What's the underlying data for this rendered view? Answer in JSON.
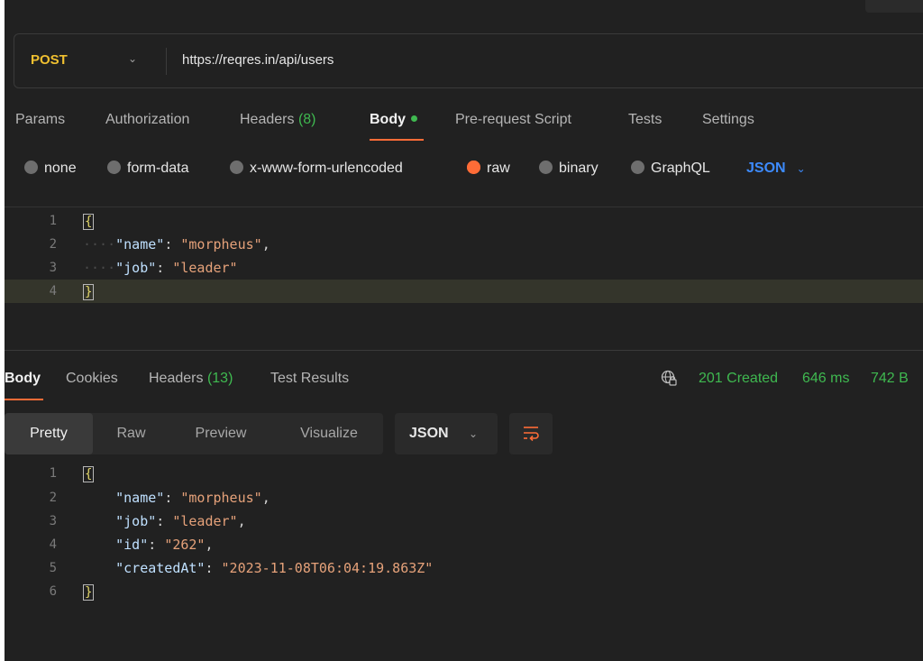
{
  "request": {
    "method": "POST",
    "url": "https://reqres.in/api/users",
    "tabs": [
      {
        "label": "Params",
        "count": ""
      },
      {
        "label": "Authorization",
        "count": ""
      },
      {
        "label": "Headers",
        "count": "(8)"
      },
      {
        "label": "Body",
        "count": ""
      },
      {
        "label": "Pre-request Script",
        "count": ""
      },
      {
        "label": "Tests",
        "count": ""
      },
      {
        "label": "Settings",
        "count": ""
      }
    ],
    "active_tab": "Body",
    "body_types": [
      "none",
      "form-data",
      "x-www-form-urlencoded",
      "raw",
      "binary",
      "GraphQL"
    ],
    "selected_body_type": "raw",
    "format": "JSON",
    "body_lines": [
      {
        "n": "1",
        "text": "{"
      },
      {
        "n": "2",
        "key": "\"name\"",
        "value": "\"morpheus\"",
        "trail": ","
      },
      {
        "n": "3",
        "key": "\"job\"",
        "value": "\"leader\"",
        "trail": ""
      },
      {
        "n": "4",
        "text": "}"
      }
    ]
  },
  "response": {
    "tabs": [
      {
        "label": "Body",
        "count": ""
      },
      {
        "label": "Cookies",
        "count": ""
      },
      {
        "label": "Headers",
        "count": "(13)"
      },
      {
        "label": "Test Results",
        "count": ""
      }
    ],
    "active_tab": "Body",
    "status": "201 Created",
    "time": "646 ms",
    "size": "742 B",
    "views": [
      "Pretty",
      "Raw",
      "Preview",
      "Visualize"
    ],
    "active_view": "Pretty",
    "format": "JSON",
    "body_lines": [
      {
        "n": "1",
        "text": "{"
      },
      {
        "n": "2",
        "key": "\"name\"",
        "value": "\"morpheus\"",
        "trail": ","
      },
      {
        "n": "3",
        "key": "\"job\"",
        "value": "\"leader\"",
        "trail": ","
      },
      {
        "n": "4",
        "key": "\"id\"",
        "value": "\"262\"",
        "trail": ","
      },
      {
        "n": "5",
        "key": "\"createdAt\"",
        "value": "\"2023-11-08T06:04:19.863Z\"",
        "trail": ""
      },
      {
        "n": "6",
        "text": "}"
      }
    ]
  },
  "colors": {
    "accent": "#ff6c37",
    "method": "#f0c030",
    "success": "#3fb950",
    "link": "#3d8bfd"
  }
}
